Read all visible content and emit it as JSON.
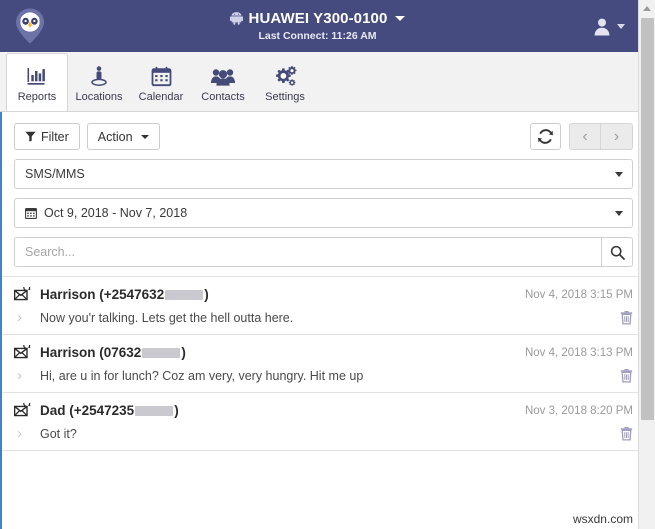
{
  "header": {
    "logo_name": "owl-pin-logo",
    "device_icon": "android-icon",
    "device_name": "HUAWEI Y300-0100",
    "last_connect": "Last Connect: 11:26 AM",
    "account_icon": "user-avatar-icon",
    "bg_color": "#464b7f"
  },
  "tabs": [
    {
      "label": "Reports",
      "icon": "bar-chart-icon",
      "active": true
    },
    {
      "label": "Locations",
      "icon": "location-pin-person-icon",
      "active": false
    },
    {
      "label": "Calendar",
      "icon": "calendar-icon",
      "active": false
    },
    {
      "label": "Contacts",
      "icon": "people-group-icon",
      "active": false
    },
    {
      "label": "Settings",
      "icon": "gears-icon",
      "active": false
    }
  ],
  "toolbar": {
    "filter_label": "Filter",
    "filter_icon": "funnel-icon",
    "action_label": "Action",
    "refresh_icon": "refresh-icon",
    "prev_icon": "chevron-left-icon",
    "prev_label": "‹",
    "next_icon": "chevron-right-icon",
    "next_label": "›"
  },
  "filters": {
    "report_type": "SMS/MMS",
    "date_range": "Oct 9, 2018 - Nov 7, 2018",
    "date_icon": "calendar-icon",
    "search_value": "",
    "search_placeholder": "Search...",
    "search_icon": "magnifier-icon"
  },
  "messages": [
    {
      "icon": "envelope-sent-icon",
      "sender_prefix": "Harrison (+2547632",
      "sender_suffix": ")",
      "date": "Nov 4, 2018 3:15 PM",
      "text": "Now you'r talking. Lets get the hell outta here.",
      "expand_icon": "chevron-right-icon",
      "delete_icon": "trash-icon"
    },
    {
      "icon": "envelope-sent-icon",
      "sender_prefix": "Harrison (07632",
      "sender_suffix": ")",
      "date": "Nov 4, 2018 3:13 PM",
      "text": "Hi, are u in for lunch? Coz am very, very hungry. Hit me up",
      "expand_icon": "chevron-right-icon",
      "delete_icon": "trash-icon"
    },
    {
      "icon": "envelope-sent-icon",
      "sender_prefix": "Dad (+2547235",
      "sender_suffix": ")",
      "date": "Nov 3, 2018 8:20 PM",
      "text": "Got it?",
      "expand_icon": "chevron-right-icon",
      "delete_icon": "trash-icon"
    }
  ],
  "scrollbar": {
    "up_arrow_icon": "triangle-up-icon"
  },
  "watermark": "wsxdn.com"
}
